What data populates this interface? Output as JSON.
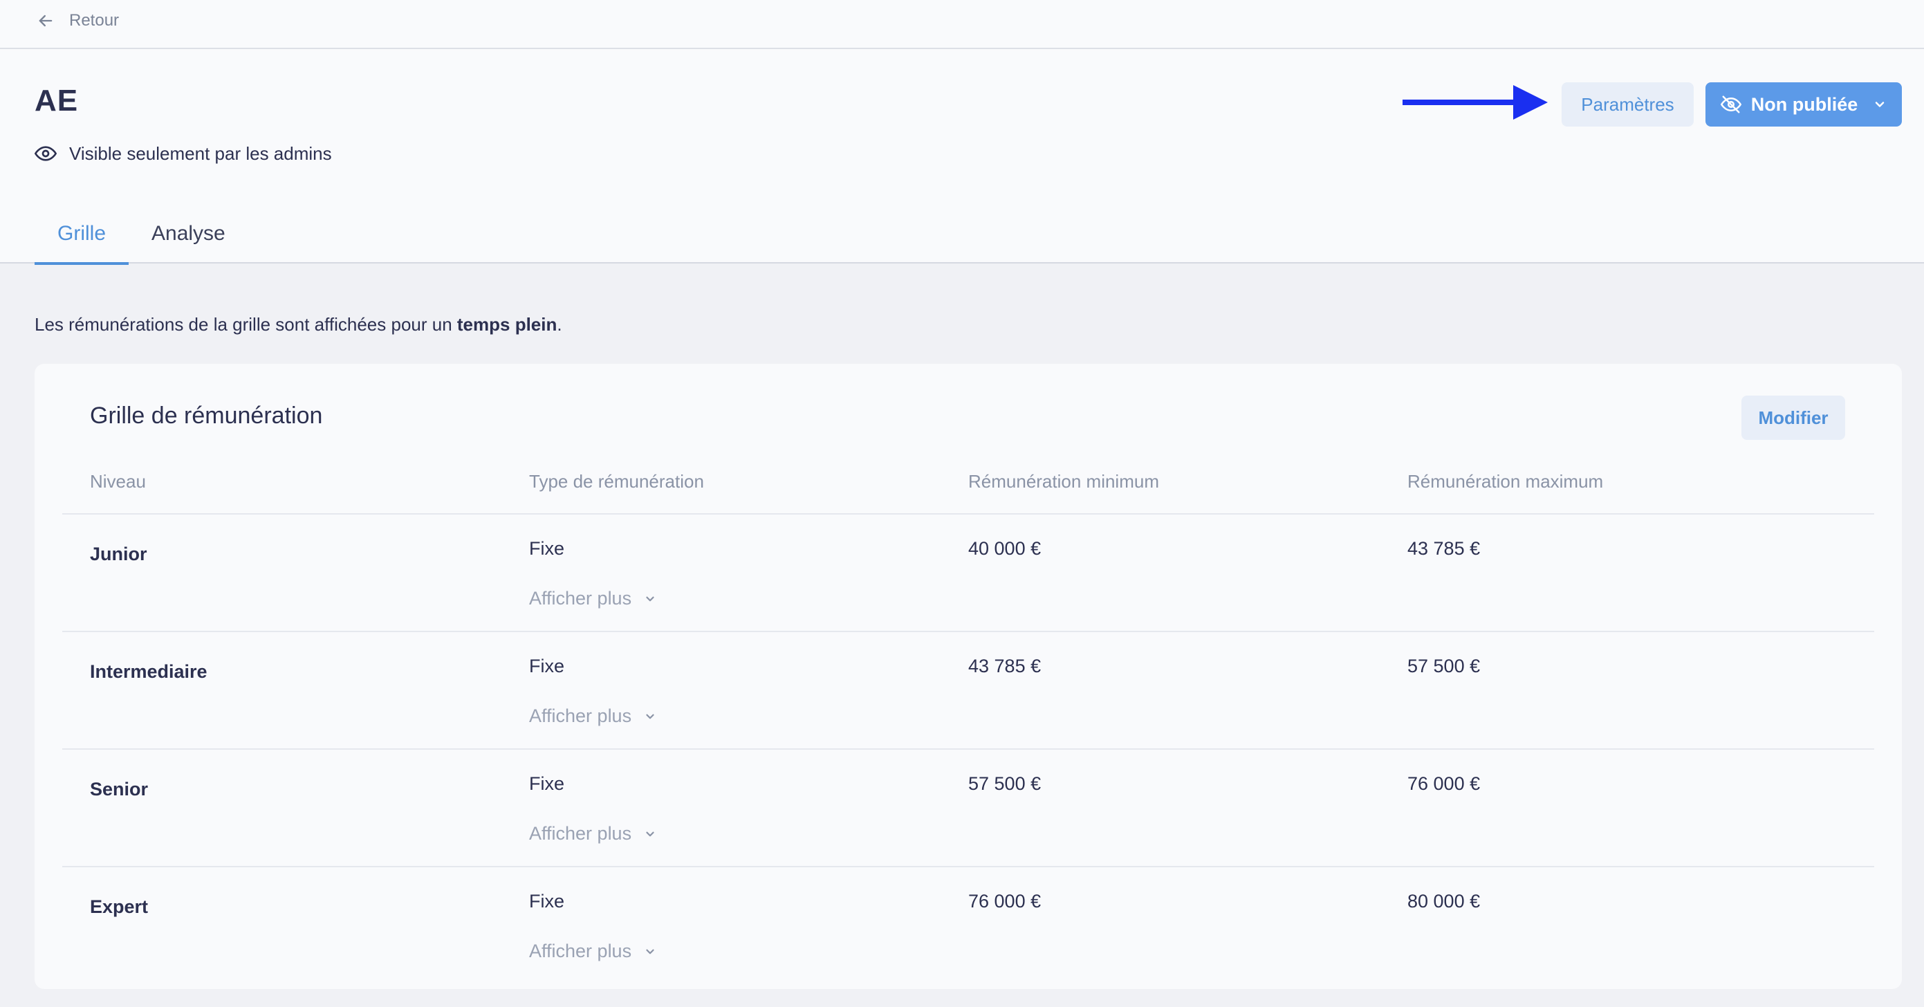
{
  "topbar": {
    "back_label": "Retour"
  },
  "header": {
    "title": "AE",
    "visibility_text": "Visible seulement par les admins",
    "params_label": "Paramètres",
    "publish_label": "Non publiée",
    "tabs": [
      {
        "label": "Grille",
        "active": true
      },
      {
        "label": "Analyse",
        "active": false
      }
    ]
  },
  "info": {
    "prefix": "Les rémunérations de la grille sont affichées pour un ",
    "bold": "temps plein",
    "suffix": "."
  },
  "grid": {
    "title": "Grille de rémunération",
    "modify_label": "Modifier",
    "columns": [
      "Niveau",
      "Type de rémunération",
      "Rémunération minimum",
      "Rémunération maximum"
    ],
    "rows": [
      {
        "level": "Junior",
        "type": "Fixe",
        "more": "Afficher plus",
        "min": "40 000 €",
        "max": "43 785 €"
      },
      {
        "level": "Intermediaire",
        "type": "Fixe",
        "more": "Afficher plus",
        "min": "43 785 €",
        "max": "57 500 €"
      },
      {
        "level": "Senior",
        "type": "Fixe",
        "more": "Afficher plus",
        "min": "57 500 €",
        "max": "76 000 €"
      },
      {
        "level": "Expert",
        "type": "Fixe",
        "more": "Afficher plus",
        "min": "76 000 €",
        "max": "80 000 €"
      }
    ]
  },
  "colors": {
    "accent": "#4f90d9",
    "publish_bg": "#5c9ae8",
    "arrow": "#1a2ff0"
  }
}
